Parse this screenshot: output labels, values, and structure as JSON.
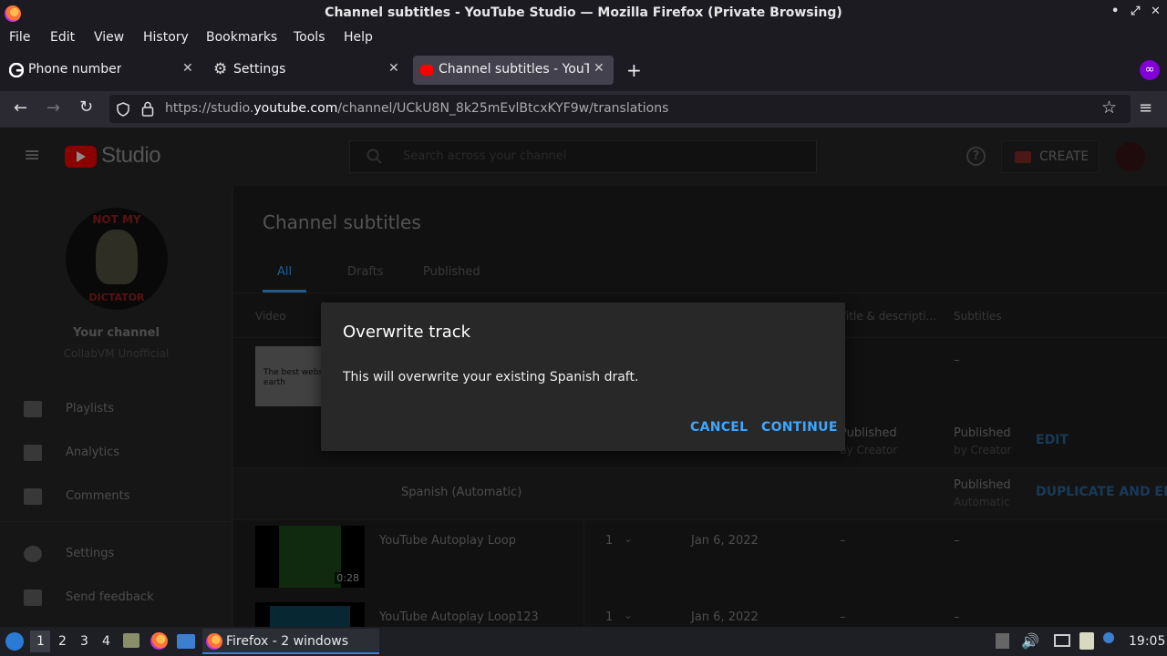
{
  "window": {
    "title": "Channel subtitles - YouTube Studio — Mozilla Firefox (Private Browsing)",
    "controls": [
      "•",
      "⤢",
      "✕"
    ]
  },
  "menu": [
    "File",
    "Edit",
    "View",
    "History",
    "Bookmarks",
    "Tools",
    "Help"
  ],
  "tabs": [
    {
      "label": "Phone number"
    },
    {
      "label": "Settings"
    },
    {
      "label": "Channel subtitles - YouTu"
    }
  ],
  "nav": {
    "url_prefix": "https://studio.",
    "url_domain": "youtube.com",
    "url_path": "/channel/UCkU8N_8k25mEvlBtcxKYF9w/translations"
  },
  "studio": {
    "logo_text": "Studio",
    "search_placeholder": "Search across your channel",
    "create_label": "CREATE",
    "help_glyph": "?",
    "channel_name": "Your channel",
    "channel_handle": "CollabVM Unofficial",
    "avatar_text_top": "NOT MY",
    "avatar_text_bottom": "DICTATOR",
    "sidebar": [
      {
        "label": "Playlists"
      },
      {
        "label": "Analytics"
      },
      {
        "label": "Comments"
      },
      {
        "label": "Settings"
      },
      {
        "label": "Send feedback"
      }
    ],
    "page_title": "Channel subtitles",
    "filter_tabs": [
      "All",
      "Drafts",
      "Published"
    ],
    "columns": {
      "video": "Video",
      "title_desc": "Title & descripti...",
      "subtitles": "Subtitles"
    },
    "rows": {
      "row1_thumb_text": "The best website on earth",
      "row1_dash1": "–",
      "row1_dash2": "–",
      "row2_title_status": "Published",
      "row2_title_by": "by Creator",
      "row2_sub_status": "Published",
      "row2_sub_by": "by Creator",
      "row2_action": "EDIT",
      "row3_lang": "Spanish (Automatic)",
      "row3_sub_status": "Published",
      "row3_sub_by": "Automatic",
      "row3_action": "DUPLICATE AND EDIT",
      "row4_title": "YouTube Autoplay Loop",
      "row4_count": "1",
      "row4_date": "Jan 6, 2022",
      "row4_duration": "0:28",
      "row4_dash1": "–",
      "row4_dash2": "–",
      "row5_title": "YouTube Autoplay Loop123",
      "row5_count": "1",
      "row5_date": "Jan 6, 2022",
      "row5_dash1": "–",
      "row5_dash2": "–"
    }
  },
  "dialog": {
    "title": "Overwrite track",
    "body": "This will overwrite your existing Spanish draft.",
    "cancel": "CANCEL",
    "continue": "CONTINUE"
  },
  "taskbar": {
    "workspaces": [
      "1",
      "2",
      "3",
      "4"
    ],
    "app_label": "Firefox - 2 windows",
    "clock": "19:05"
  },
  "colors": {
    "accent": "#3ea6ff",
    "youtube_red": "#ff0000",
    "private": "#8000d7"
  }
}
